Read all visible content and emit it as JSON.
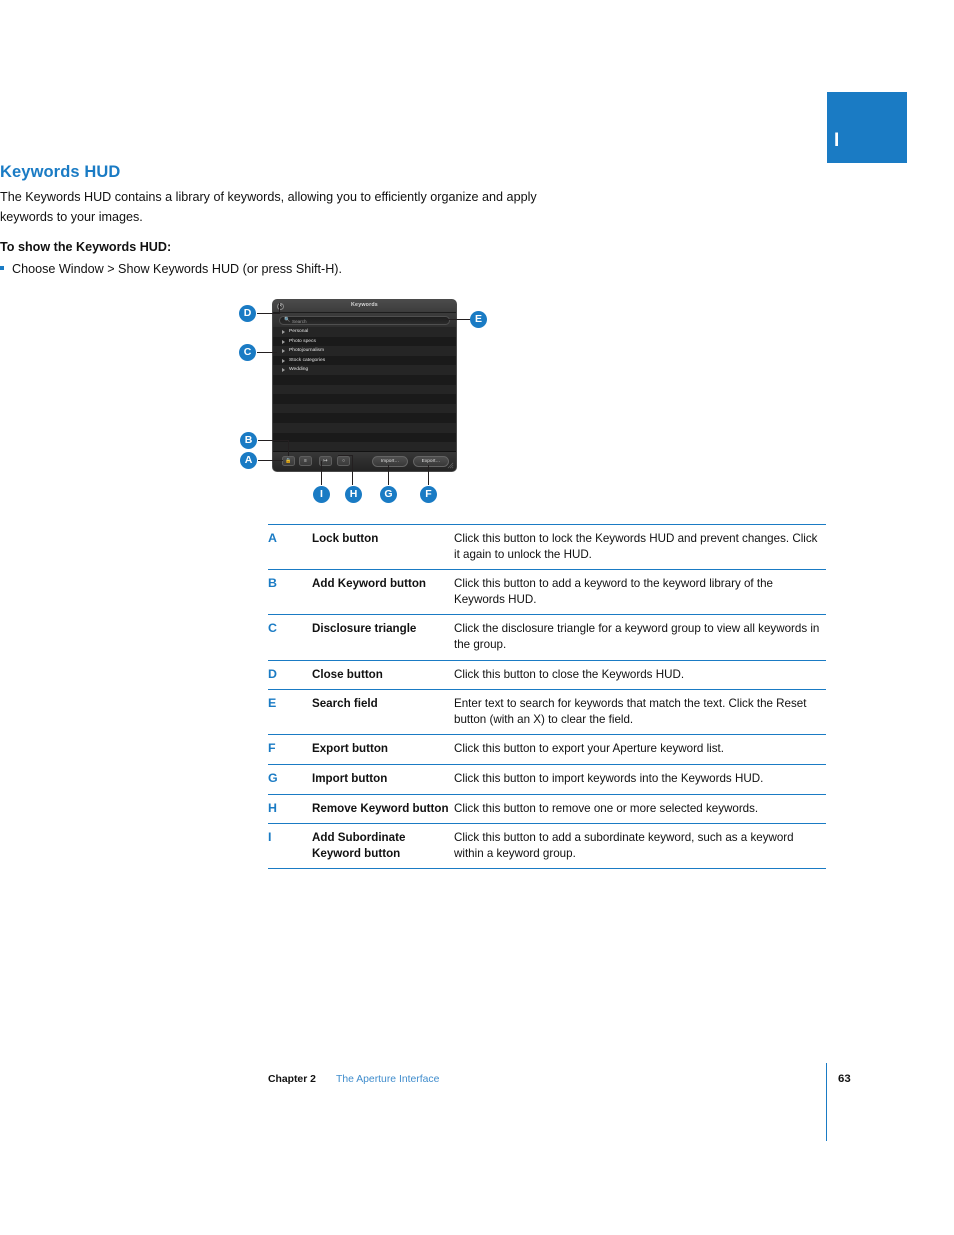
{
  "page": {
    "chapter_tab_letter": "I",
    "accent_color": "#1a7bc4",
    "text_color": "#111111"
  },
  "section": {
    "title": "Keywords HUD",
    "intro": "The Keywords HUD contains a library of keywords, allowing you to efficiently organize and apply keywords to your images.",
    "howto_heading": "To show the Keywords HUD:",
    "howto_step": "Choose Window > Show Keywords HUD (or press Shift-H)."
  },
  "figure": {
    "hud": {
      "window_title": "Keywords",
      "close_icon": "close-icon",
      "search": {
        "icon": "search-icon",
        "placeholder": "Search",
        "value": ""
      },
      "keywords": [
        {
          "label": "Personal",
          "disclosure": "disclosure-triangle"
        },
        {
          "label": "Photo specs",
          "disclosure": "disclosure-triangle"
        },
        {
          "label": "Photojournalism",
          "disclosure": "disclosure-triangle"
        },
        {
          "label": "Stock categories",
          "disclosure": "disclosure-triangle"
        },
        {
          "label": "Wedding",
          "disclosure": "disclosure-triangle"
        }
      ],
      "toolbar": {
        "lock_button_icon": "lock-icon",
        "add_keyword_button_icon": "add-keyword-icon",
        "add_subordinate_button_icon": "add-subordinate-keyword-icon",
        "remove_keyword_button_icon": "remove-keyword-icon",
        "import_label": "Import…",
        "export_label": "Export…",
        "resize_grip_icon": "resize-grip-icon"
      }
    },
    "callouts": [
      {
        "letter": "A"
      },
      {
        "letter": "B"
      },
      {
        "letter": "C"
      },
      {
        "letter": "D"
      },
      {
        "letter": "E"
      },
      {
        "letter": "F"
      },
      {
        "letter": "G"
      },
      {
        "letter": "H"
      },
      {
        "letter": "I"
      }
    ]
  },
  "reference_table": {
    "rows": [
      {
        "letter": "A",
        "term": "Lock button",
        "description": "Click this button to lock the Keywords HUD and prevent changes. Click it again to unlock the HUD."
      },
      {
        "letter": "B",
        "term": "Add Keyword button",
        "description": "Click this button to add a keyword to the keyword library of the Keywords HUD."
      },
      {
        "letter": "C",
        "term": "Disclosure triangle",
        "description": "Click the disclosure triangle for a keyword group to view all keywords in the group."
      },
      {
        "letter": "D",
        "term": "Close button",
        "description": "Click this button to close the Keywords HUD."
      },
      {
        "letter": "E",
        "term": "Search field",
        "description": "Enter text to search for keywords that match the text. Click the Reset button (with an X) to clear the field."
      },
      {
        "letter": "F",
        "term": "Export button",
        "description": "Click this button to export your Aperture keyword list."
      },
      {
        "letter": "G",
        "term": "Import button",
        "description": "Click this button to import keywords into the Keywords HUD."
      },
      {
        "letter": "H",
        "term": "Remove Keyword button",
        "description": "Click this button to remove one or more selected keywords."
      },
      {
        "letter": "I",
        "term": "Add Subordinate Keyword button",
        "description": "Click this button to add a subordinate keyword, such as a keyword within a keyword group."
      }
    ]
  },
  "footer": {
    "chapter": "Chapter 2",
    "chapter_title": "The Aperture Interface",
    "page_number": "63"
  }
}
